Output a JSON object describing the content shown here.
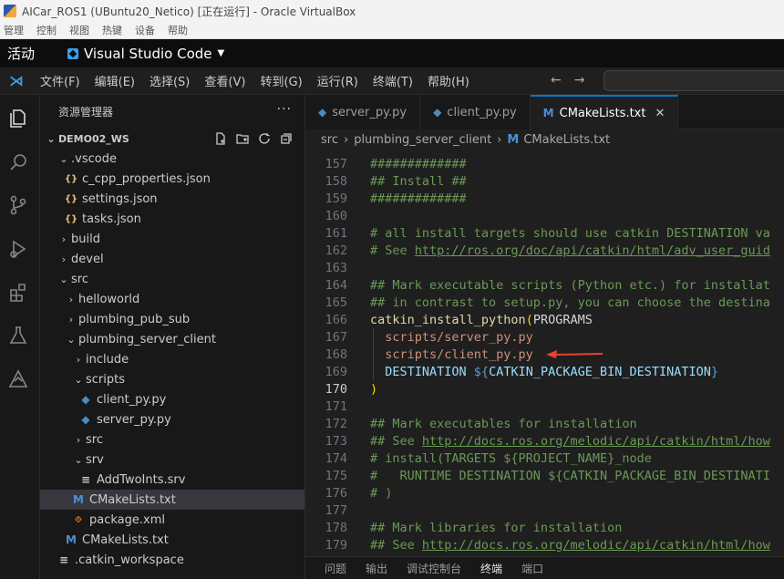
{
  "vbox": {
    "title": "AICar_ROS1 (UBuntu20_Netico) [正在运行] - Oracle VirtualBox",
    "menu": [
      "管理",
      "控制",
      "视图",
      "热键",
      "设备",
      "帮助"
    ]
  },
  "gnome": {
    "activities": "活动",
    "app_name": "Visual Studio Code"
  },
  "vscode": {
    "menu": [
      "文件(F)",
      "编辑(E)",
      "选择(S)",
      "查看(V)",
      "转到(G)",
      "运行(R)",
      "终端(T)",
      "帮助(H)"
    ],
    "sidebar": {
      "title": "资源管理器",
      "workspace": "DEMO02_WS",
      "tree": [
        {
          "label": ".vscode",
          "kind": "folder-open",
          "depth": 1
        },
        {
          "label": "c_cpp_properties.json",
          "kind": "json",
          "depth": 2
        },
        {
          "label": "settings.json",
          "kind": "json",
          "depth": 2
        },
        {
          "label": "tasks.json",
          "kind": "json",
          "depth": 2
        },
        {
          "label": "build",
          "kind": "folder",
          "depth": 1
        },
        {
          "label": "devel",
          "kind": "folder",
          "depth": 1
        },
        {
          "label": "src",
          "kind": "folder-open",
          "depth": 1
        },
        {
          "label": "helloworld",
          "kind": "folder",
          "depth": 2
        },
        {
          "label": "plumbing_pub_sub",
          "kind": "folder",
          "depth": 2
        },
        {
          "label": "plumbing_server_client",
          "kind": "folder-open",
          "depth": 2
        },
        {
          "label": "include",
          "kind": "folder",
          "depth": 3
        },
        {
          "label": "scripts",
          "kind": "folder-open",
          "depth": 3
        },
        {
          "label": "client_py.py",
          "kind": "py",
          "depth": 4
        },
        {
          "label": "server_py.py",
          "kind": "py",
          "depth": 4
        },
        {
          "label": "src",
          "kind": "folder",
          "depth": 3
        },
        {
          "label": "srv",
          "kind": "folder-open",
          "depth": 3
        },
        {
          "label": "AddTwoInts.srv",
          "kind": "srv",
          "depth": 4
        },
        {
          "label": "CMakeLists.txt",
          "kind": "cmake",
          "depth": 3,
          "selected": true
        },
        {
          "label": "package.xml",
          "kind": "xml",
          "depth": 3
        },
        {
          "label": "CMakeLists.txt",
          "kind": "cmake",
          "depth": 2
        },
        {
          "label": ".catkin_workspace",
          "kind": "srv",
          "depth": 1
        }
      ]
    },
    "tabs": [
      {
        "label": "server_py.py",
        "icon": "python-icon"
      },
      {
        "label": "client_py.py",
        "icon": "python-icon"
      },
      {
        "label": "CMakeLists.txt",
        "icon": "cmake-icon",
        "active": true
      }
    ],
    "breadcrumb": [
      "src",
      "plumbing_server_client",
      "CMakeLists.txt"
    ],
    "code": [
      {
        "n": "157",
        "t": "c",
        "s": "#############"
      },
      {
        "n": "158",
        "t": "c",
        "s": "## Install ##"
      },
      {
        "n": "159",
        "t": "c",
        "s": "#############"
      },
      {
        "n": "160",
        "t": "c",
        "s": ""
      },
      {
        "n": "161",
        "t": "c",
        "s": "# all install targets should use catkin DESTINATION va"
      },
      {
        "n": "162",
        "t": "link",
        "s": "# See ",
        "link": "http://ros.org/doc/api/catkin/html/adv_user_guid"
      },
      {
        "n": "163",
        "t": "c",
        "s": ""
      },
      {
        "n": "164",
        "t": "c",
        "s": "## Mark executable scripts (Python etc.) for installat"
      },
      {
        "n": "165",
        "t": "c",
        "s": "## in contrast to setup.py, you can choose the destina"
      },
      {
        "n": "166",
        "t": "func",
        "s": "catkin_install_python",
        "arg": "PROGRAMS"
      },
      {
        "n": "167",
        "t": "str",
        "s": "scripts/server_py.py"
      },
      {
        "n": "168",
        "t": "str",
        "s": "scripts/client_py.py"
      },
      {
        "n": "169",
        "t": "dest",
        "s": "DESTINATION ",
        "var": "CATKIN_PACKAGE_BIN_DESTINATION"
      },
      {
        "n": "170",
        "t": "close",
        "s": ")",
        "current": true
      },
      {
        "n": "171",
        "t": "c",
        "s": ""
      },
      {
        "n": "172",
        "t": "c",
        "s": "## Mark executables for installation"
      },
      {
        "n": "173",
        "t": "link",
        "s": "## See ",
        "link": "http://docs.ros.org/melodic/api/catkin/html/how"
      },
      {
        "n": "174",
        "t": "c",
        "s": "# install(TARGETS ${PROJECT_NAME}_node"
      },
      {
        "n": "175",
        "t": "c",
        "s": "#   RUNTIME DESTINATION ${CATKIN_PACKAGE_BIN_DESTINATI"
      },
      {
        "n": "176",
        "t": "c",
        "s": "# )"
      },
      {
        "n": "177",
        "t": "c",
        "s": ""
      },
      {
        "n": "178",
        "t": "c",
        "s": "## Mark libraries for installation"
      },
      {
        "n": "179",
        "t": "link",
        "s": "## See ",
        "link": "http://docs.ros.org/melodic/api/catkin/html/how"
      }
    ],
    "panel_tabs": [
      "问题",
      "输出",
      "调试控制台",
      "终端",
      "端口"
    ],
    "panel_active": "终端",
    "accent": "#0078d4",
    "annotation_arrow_color": "#e8432f"
  }
}
